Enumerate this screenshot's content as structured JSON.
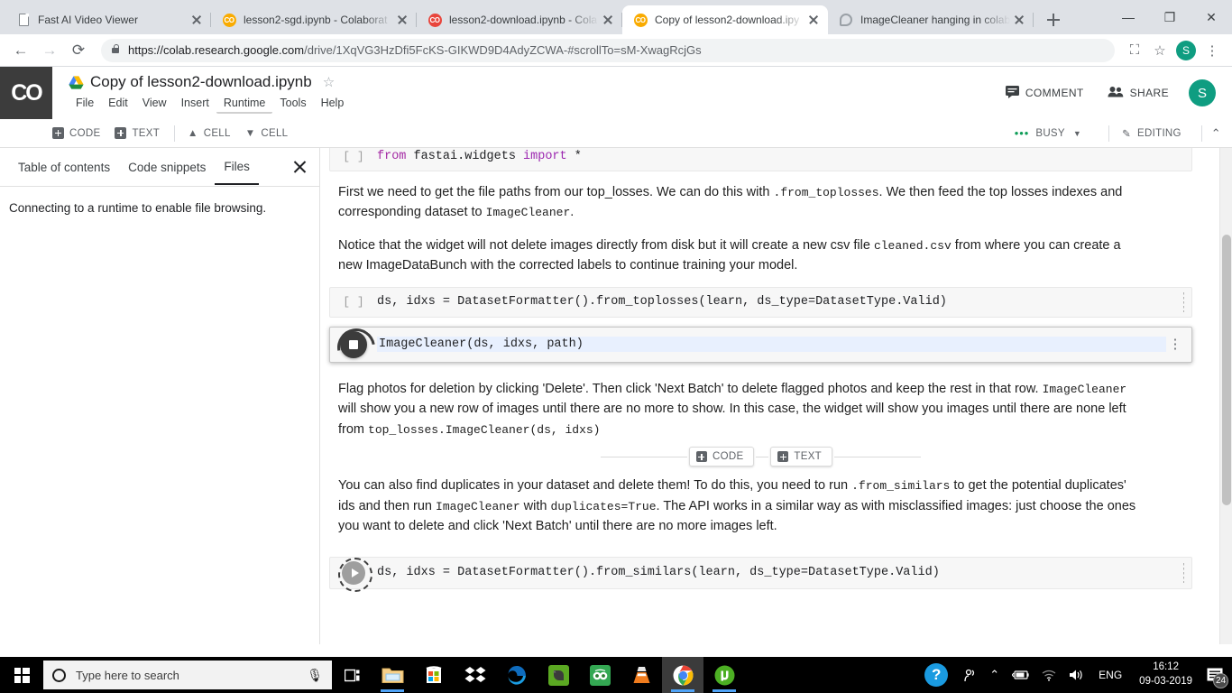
{
  "browser": {
    "tabs": [
      {
        "title": "Fast AI Video Viewer",
        "favicon": "document-icon",
        "active": false
      },
      {
        "title": "lesson2-sgd.ipynb - Colaborat",
        "favicon": "colab-icon",
        "active": false
      },
      {
        "title": "lesson2-download.ipynb - Cola",
        "favicon": "colab-icon-red",
        "active": false
      },
      {
        "title": "Copy of lesson2-download.ipy",
        "favicon": "colab-icon",
        "active": true
      },
      {
        "title": "ImageCleaner hanging in colab",
        "favicon": "thread-icon",
        "active": false
      }
    ],
    "new_tab_label": "+",
    "window_controls": {
      "minimize": "—",
      "maximize": "❐",
      "close": "✕"
    },
    "nav": {
      "back": "←",
      "forward": "→",
      "reload": "⟳"
    },
    "url_domain": "https://colab.research.google.com",
    "url_path": "/drive/1XqVG3HzDfi5FcKS-GIKWD9D4AdyZCWA-#scrollTo=sM-XwagRcjGs",
    "omnibox_icons": {
      "cast": "⛶",
      "bookmark": "☆",
      "menu": "⋮"
    },
    "profile_initial": "S"
  },
  "colab": {
    "logo_text": "CO",
    "notebook_title": "Copy of lesson2-download.ipynb",
    "star_glyph": "☆",
    "menus": [
      "File",
      "Edit",
      "View",
      "Insert",
      "Runtime",
      "Tools",
      "Help"
    ],
    "hovered_menu": "Runtime",
    "comment_label": "COMMENT",
    "comment_icon": "comment-icon",
    "share_label": "SHARE",
    "share_icon": "people-icon",
    "avatar_initial": "S",
    "toolbar": {
      "add_code": "CODE",
      "add_text": "TEXT",
      "move_cell_up": "CELL",
      "move_cell_down": "CELL",
      "busy_label": "BUSY",
      "busy_dots": "•••",
      "busy_color": "#0f9d58",
      "editing_label": "EDITING",
      "editing_icon": "pencil-icon",
      "collapse_icon": "chevron-up-icon",
      "dropdown_icon": "chevron-down-icon"
    }
  },
  "sidebar": {
    "tabs": [
      {
        "label": "Table of contents",
        "active": false
      },
      {
        "label": "Code snippets",
        "active": false
      },
      {
        "label": "Files",
        "active": true
      }
    ],
    "close_icon": "close-icon",
    "message": "Connecting to a runtime to enable file browsing."
  },
  "notebook": {
    "cells": [
      {
        "type": "code",
        "prompt": "[ ]",
        "state": "idle",
        "code_prefix": "from",
        "code_middle": " fastai.widgets ",
        "code_keyword2": "import",
        "code_suffix": " *"
      },
      {
        "type": "markdown",
        "paragraphs": [
          "First we need to get the file paths from our top_losses. We can do this with .from_toplosses. We then feed the top losses indexes and corresponding dataset to ImageCleaner.",
          "Notice that the widget will not delete images directly from disk but it will create a new csv file cleaned.csv from where you can create a new ImageDataBunch with the corrected labels to continue training your model."
        ]
      },
      {
        "type": "code",
        "prompt": "[ ]",
        "state": "idle",
        "code": "ds, idxs = DatasetFormatter().from_toplosses(learn, ds_type=DatasetType.Valid)"
      },
      {
        "type": "code",
        "prompt": "",
        "state": "running",
        "selected": true,
        "code": "ImageCleaner(ds, idxs, path)",
        "kebab_icon": "more-vert-icon",
        "run_icon": "stop-icon"
      },
      {
        "type": "markdown",
        "paragraphs": [
          "Flag photos for deletion by clicking 'Delete'. Then click 'Next Batch' to delete flagged photos and keep the rest in that row. ImageCleaner will show you a new row of images until there are no more to show. In this case, the widget will show you images until there are none left from top_losses.ImageCleaner(ds, idxs)"
        ]
      },
      {
        "type": "markdown",
        "paragraphs": [
          "You can also find duplicates in your dataset and delete them! To do this, you need to run .from_similars to get the potential duplicates' ids and then run ImageCleaner with duplicates=True. The API works in a similar way as with misclassified images: just choose the ones you want to delete and click 'Next Batch' until there are no more images left."
        ]
      },
      {
        "type": "code",
        "prompt": "",
        "state": "pending",
        "code": "ds, idxs = DatasetFormatter().from_similars(learn, ds_type=DatasetType.Valid)",
        "run_icon": "play-icon"
      }
    ],
    "insert_bar": {
      "code_label": "CODE",
      "text_label": "TEXT"
    }
  },
  "taskbar": {
    "start_icon": "windows-logo-icon",
    "search_placeholder": "Type here to search",
    "search_icon": "search-circle-icon",
    "mic_icon": "microphone-icon",
    "task_view_icon": "task-view-icon",
    "apps": [
      {
        "name": "file-explorer-icon",
        "running": true,
        "active": false
      },
      {
        "name": "microsoft-store-icon",
        "running": false,
        "active": false
      },
      {
        "name": "dropbox-icon",
        "running": false,
        "active": false
      },
      {
        "name": "microsoft-edge-icon",
        "running": false,
        "active": false
      },
      {
        "name": "evernote-icon",
        "running": false,
        "active": false
      },
      {
        "name": "tripadvisor-icon",
        "running": false,
        "active": false
      },
      {
        "name": "vlc-icon",
        "running": false,
        "active": false
      },
      {
        "name": "google-chrome-icon",
        "running": true,
        "active": true
      },
      {
        "name": "utorrent-icon",
        "running": true,
        "active": false
      }
    ],
    "tray": {
      "help_icon": "help-circle-icon",
      "person_icon": "people-nearby-icon",
      "chevron_icon": "show-hidden-icons-icon",
      "battery_icon": "battery-charging-icon",
      "wifi_icon": "wifi-icon",
      "volume_icon": "volume-icon",
      "language": "ENG",
      "time": "16:12",
      "date": "09-03-2019",
      "notification_icon": "action-center-icon",
      "notification_count": "24"
    }
  }
}
